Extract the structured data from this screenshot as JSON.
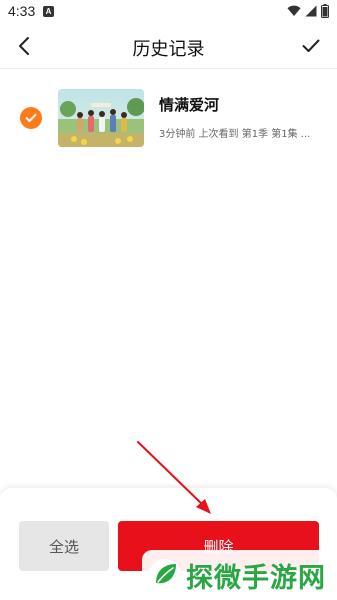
{
  "status_bar": {
    "time": "4:33",
    "notification_badge": "A"
  },
  "header": {
    "title": "历史记录",
    "back_icon": "chevron-left-icon",
    "confirm_icon": "check-icon"
  },
  "history_items": [
    {
      "title": "情满爱河",
      "meta": "3分钟前  上次看到  第1季  第1集 ...",
      "selected": true
    }
  ],
  "bottom_bar": {
    "select_all_label": "全选",
    "delete_label": "删除"
  },
  "watermark": {
    "text": "探微手游网"
  },
  "colors": {
    "accent_orange": "#ff7a1a",
    "delete_red": "#e8101a",
    "select_all_bg": "#e6e6e6",
    "arrow_red": "#e8101a",
    "watermark_green": "#2aa745"
  }
}
